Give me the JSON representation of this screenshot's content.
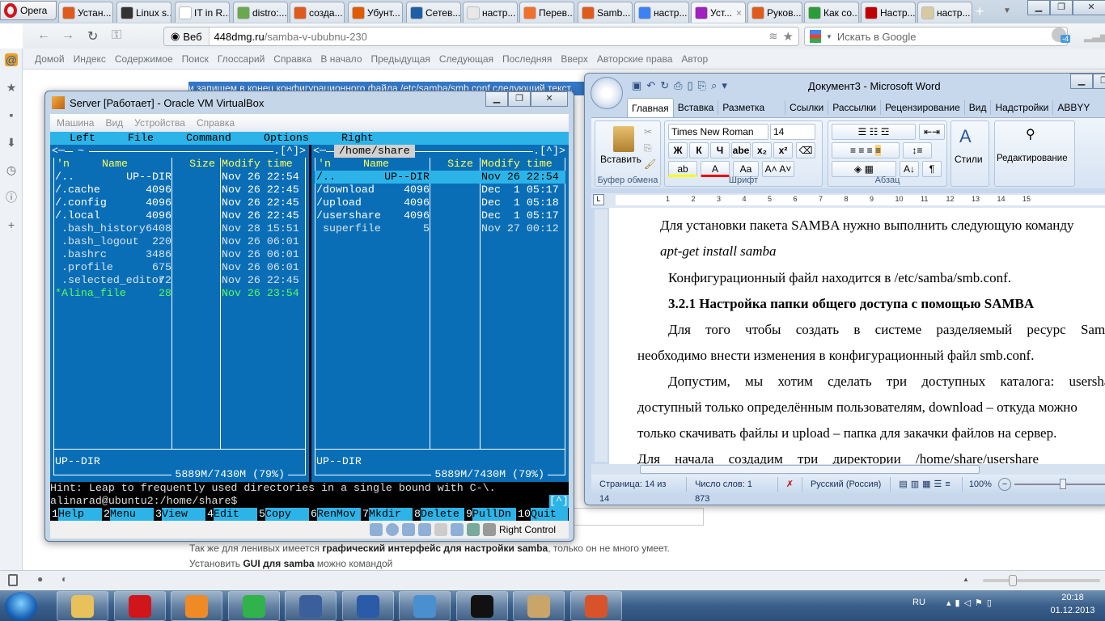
{
  "browser": {
    "opera_label": "Opera",
    "tabs": [
      {
        "label": "Устан...",
        "color": "#e05a1c"
      },
      {
        "label": "Linux s...",
        "color": "#333333"
      },
      {
        "label": "IT in R...",
        "color": "#ffffff"
      },
      {
        "label": "distro:...",
        "color": "#6aa84f"
      },
      {
        "label": "созда...",
        "color": "#e05a1c"
      },
      {
        "label": "Убунт...",
        "color": "#e05a00"
      },
      {
        "label": "Сетев...",
        "color": "#1f5fa8"
      },
      {
        "label": "настр...",
        "color": "#e8e8e8"
      },
      {
        "label": "Перев...",
        "color": "#f0712c"
      },
      {
        "label": "Samb...",
        "color": "#e05a1c"
      },
      {
        "label": "настр...",
        "color": "#3b82f6"
      },
      {
        "label": "Уст...",
        "color": "#a020c0",
        "active": true
      },
      {
        "label": "Руков...",
        "color": "#e05a1c"
      },
      {
        "label": "Как со...",
        "color": "#2a9d3a"
      },
      {
        "label": "Настр...",
        "color": "#c00000"
      },
      {
        "label": "настр...",
        "color": "#d9c9a0"
      }
    ],
    "address_prefix": "Веб",
    "address_domain": "448dmg.ru",
    "address_path": "/samba-v-ububnu-230",
    "search_placeholder": "Искать в Google",
    "badge": "-4",
    "links": [
      "Домой",
      "Индекс",
      "Содержимое",
      "Поиск",
      "Глоссарий",
      "Справка",
      "В начало",
      "Предыдущая",
      "Следующая",
      "Последняя",
      "Вверх",
      "Авторские права",
      "Автор"
    ]
  },
  "page": {
    "highlighted_line": "и запишем в конец конфигурационного файла /etc/samba/smb.conf следующий текст.",
    "p1_a": "Так же для ленивых имеется ",
    "p1_b": "графический интерфейс для настройки samba",
    "p1_c": ", только он не много умеет.",
    "p2_a": "Установить ",
    "p2_b": "GUI для samba",
    "p2_c": " можно командой"
  },
  "vbox": {
    "title": "Server [Работает] - Oracle VM VirtualBox",
    "menu": [
      "Машина",
      "Вид",
      "Устройства",
      "Справка"
    ],
    "status_key": "Right Control",
    "mc": {
      "menubar": [
        "Left",
        "File",
        "Command",
        "Options",
        "Right"
      ],
      "left_path": "~",
      "right_path": "/home/share",
      "corner": ".[^]>",
      "headers": {
        "n": "'n",
        "name": "Name",
        "size": "Size",
        "time": "Modify time"
      },
      "left_files": [
        {
          "name": "/..",
          "size": "UP--DIR",
          "time": "Nov 26 22:54",
          "kind": "dir"
        },
        {
          "name": "/.cache",
          "size": "4096",
          "time": "Nov 26 22:45",
          "kind": "dir"
        },
        {
          "name": "/.config",
          "size": "4096",
          "time": "Nov 26 22:45",
          "kind": "dir"
        },
        {
          "name": "/.local",
          "size": "4096",
          "time": "Nov 26 22:45",
          "kind": "dir"
        },
        {
          "name": " .bash_history",
          "size": "6408",
          "time": "Nov 28 15:51",
          "kind": "file"
        },
        {
          "name": " .bash_logout",
          "size": "220",
          "time": "Nov 26 06:01",
          "kind": "file"
        },
        {
          "name": " .bashrc",
          "size": "3486",
          "time": "Nov 26 06:01",
          "kind": "file"
        },
        {
          "name": " .profile",
          "size": "675",
          "time": "Nov 26 06:01",
          "kind": "file"
        },
        {
          "name": " .selected_editor",
          "size": "72",
          "time": "Nov 26 22:45",
          "kind": "file"
        },
        {
          "name": "*Alina_file",
          "size": "28",
          "time": "Nov 26 23:54",
          "kind": "exec"
        }
      ],
      "right_files": [
        {
          "name": "/..",
          "size": "UP--DIR",
          "time": "Nov 26 22:54",
          "kind": "selected"
        },
        {
          "name": "/download",
          "size": "4096",
          "time": "Dec  1 05:17",
          "kind": "dir"
        },
        {
          "name": "/upload",
          "size": "4096",
          "time": "Dec  1 05:18",
          "kind": "dir"
        },
        {
          "name": "/usershare",
          "size": "4096",
          "time": "Dec  1 05:17",
          "kind": "dir"
        },
        {
          "name": " superfile",
          "size": "5",
          "time": "Nov 27 00:12",
          "kind": "file"
        }
      ],
      "left_footer": "UP--DIR",
      "right_footer": "UP--DIR",
      "left_disk": "5889M/7430M (79%)",
      "right_disk": "5889M/7430M (79%)",
      "hint": "Hint: Leap to frequently used directories in a single bound with C-\\.",
      "prompt": "alinarad@ubuntu2:/home/share$",
      "prompt_corner": "[^]",
      "fkeys": [
        {
          "n": "1",
          "label": "Help"
        },
        {
          "n": "2",
          "label": "Menu"
        },
        {
          "n": "3",
          "label": "View"
        },
        {
          "n": "4",
          "label": "Edit"
        },
        {
          "n": "5",
          "label": "Copy"
        },
        {
          "n": "6",
          "label": "RenMov"
        },
        {
          "n": "7",
          "label": "Mkdir"
        },
        {
          "n": "8",
          "label": "Delete"
        },
        {
          "n": "9",
          "label": "PullDn"
        },
        {
          "n": "10",
          "label": "Quit"
        }
      ]
    }
  },
  "word": {
    "title": "Документ3 - Microsoft Word",
    "tabs": [
      "Главная",
      "Вставка",
      "Разметка страни",
      "Ссылки",
      "Рассылки",
      "Рецензирование",
      "Вид",
      "Надстройки",
      "ABBYY FineR"
    ],
    "font_name": "Times New Roman",
    "font_size": "14",
    "paste_label": "Вставить",
    "styles_label": "Стили",
    "editing_label": "Редактирование",
    "groups": [
      "Буфер обмена",
      "Шрифт",
      "Абзац"
    ],
    "format_buttons": [
      "Ж",
      "К",
      "Ч",
      "abe",
      "x₂",
      "x²"
    ],
    "ruler_marks": [
      "1",
      "2",
      "3",
      "4",
      "5",
      "6",
      "7",
      "8",
      "9",
      "10",
      "11",
      "12",
      "13",
      "14",
      "15"
    ],
    "lines": [
      "Для установки пакета SAMBA нужно выполнить следующую команду",
      "apt-get install samba",
      "Конфигурационный файл находится в  /etc/samba/smb.conf.",
      "3.2.1 Настройка папки общего доступа с помощью SAMBA",
      "Для того чтобы создать в системе разделяемый ресурс Samba",
      "необходимо внести изменения в конфигурационный файл smb.conf.",
      "Допустим, мы хотим сделать три доступных каталога: usershare –",
      "доступный только определённым пользователям, download – откуда можно",
      "только скачивать файлы и upload – папка для закачки файлов на сервер.",
      "Для начала создадим три директории /home/share/usershare"
    ],
    "status": {
      "page": "Страница: 14 из 14",
      "words": "Число слов: 1 873",
      "lang": "Русский (Россия)",
      "zoom": "100%"
    }
  },
  "taskbar": {
    "lang": "RU",
    "time": "20:18",
    "date": "01.12.2013",
    "apps": [
      {
        "name": "explorer",
        "color": "#e8c15a"
      },
      {
        "name": "opera",
        "color": "#d0161b"
      },
      {
        "name": "media-player",
        "color": "#f08a24"
      },
      {
        "name": "mail-agent",
        "color": "#2fb34a"
      },
      {
        "name": "virtualbox",
        "color": "#3b5f9a"
      },
      {
        "name": "word",
        "color": "#2a5aa8"
      },
      {
        "name": "control-panel",
        "color": "#4a8fd0"
      },
      {
        "name": "cmd",
        "color": "#111111"
      },
      {
        "name": "paint",
        "color": "#c9a56a"
      },
      {
        "name": "powerpoint",
        "color": "#d9532a"
      }
    ]
  }
}
